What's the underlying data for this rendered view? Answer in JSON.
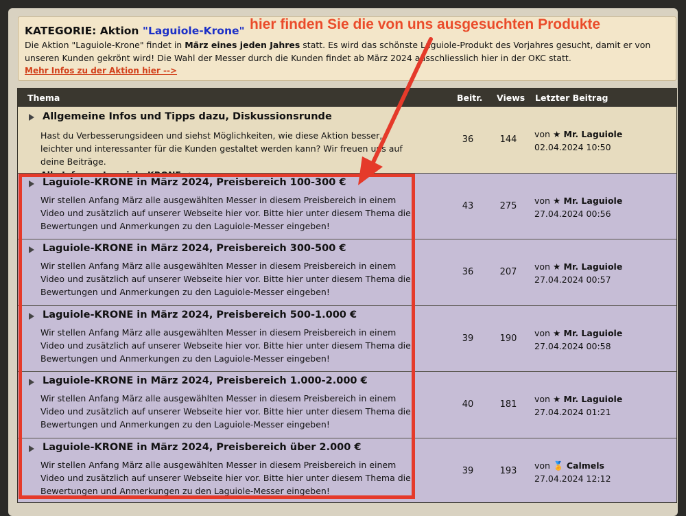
{
  "category": {
    "label": "KATEGORIE: Aktion",
    "name": "\"Laguiole-Krone\"",
    "text_1": "Die Aktion \"Laguiole-Krone\" findet in ",
    "text_bold": "März eines jeden Jahres",
    "text_2": " statt. Es wird das schönste Laguiole-Produkt des Vorjahres gesucht, damit er von unseren Kunden gekrönt wird! Die Wahl der Messer durch die Kunden findet ab März 2024 ausschliesslich hier in der OKC statt.",
    "more_link": "Mehr Infos zu der Aktion hier -->"
  },
  "annotation": "hier finden Sie die von uns ausgesuchten Produkte",
  "table": {
    "headers": {
      "topic": "Thema",
      "posts": "Beitr.",
      "views": "Views",
      "last": "Letzter Beitrag"
    },
    "rows": [
      {
        "title": "Allgemeine Infos und Tipps dazu, Diskussionsrunde",
        "desc": "Hast du Verbesserungsideen und siehst Möglichkeiten, wie diese Aktion besser, leichter und interessanter für die Kunden gestaltet werden kann? Wir freuen uns auf deine Beiträge.",
        "more": "Alle Infos zu Laguiole-KRONE-->",
        "posts": "36",
        "views": "144",
        "by": "von",
        "user": "★ Mr. Laguiole",
        "date": "02.04.2024 10:50"
      },
      {
        "title": "Laguiole-KRONE in März 2024, Preisbereich 100-300 €",
        "desc": "Wir stellen Anfang März alle ausgewählten Messer in diesem Preisbereich in einem Video und zusätzlich auf unserer Webseite hier vor. Bitte hier unter diesem Thema die Bewertungen und Anmerkungen zu den Laguiole-Messer eingeben!",
        "posts": "43",
        "views": "275",
        "by": "von",
        "user": "★ Mr. Laguiole",
        "date": "27.04.2024 00:56"
      },
      {
        "title": "Laguiole-KRONE in März 2024, Preisbereich 300-500 €",
        "desc": "Wir stellen Anfang März alle ausgewählten Messer in diesem Preisbereich in einem Video und zusätzlich auf unserer Webseite hier vor. Bitte hier unter diesem Thema die Bewertungen und Anmerkungen zu den Laguiole-Messer eingeben!",
        "posts": "36",
        "views": "207",
        "by": "von",
        "user": "★ Mr. Laguiole",
        "date": "27.04.2024 00:57"
      },
      {
        "title": "Laguiole-KRONE in März 2024, Preisbereich 500-1.000 €",
        "desc": "Wir stellen Anfang März alle ausgewählten Messer in diesem Preisbereich in einem Video und zusätzlich auf unserer Webseite hier vor. Bitte hier unter diesem Thema die Bewertungen und Anmerkungen zu den Laguiole-Messer eingeben!",
        "posts": "39",
        "views": "190",
        "by": "von",
        "user": "★ Mr. Laguiole",
        "date": "27.04.2024 00:58"
      },
      {
        "title": "Laguiole-KRONE in März 2024, Preisbereich 1.000-2.000 €",
        "desc": "Wir stellen Anfang März alle ausgewählten Messer in diesem Preisbereich in einem Video und zusätzlich auf unserer Webseite hier vor. Bitte hier unter diesem Thema die Bewertungen und Anmerkungen zu den Laguiole-Messer eingeben!",
        "posts": "40",
        "views": "181",
        "by": "von",
        "user": "★ Mr. Laguiole",
        "date": "27.04.2024 01:21"
      },
      {
        "title": "Laguiole-KRONE in März 2024, Preisbereich über 2.000 €",
        "desc": "Wir stellen Anfang März alle ausgewählten Messer in diesem Preisbereich in einem Video und zusätzlich auf unserer Webseite hier vor. Bitte hier unter diesem Thema die Bewertungen und Anmerkungen zu den Laguiole-Messer eingeben!",
        "posts": "39",
        "views": "193",
        "by": "von",
        "user": "🏅 Calmels",
        "date": "27.04.2024 12:12"
      }
    ]
  },
  "colors": {
    "accent": "#e53a2a",
    "link": "#1b2fc7",
    "info_row": "#e7dcbf",
    "topic_row": "#c6bdd6"
  }
}
